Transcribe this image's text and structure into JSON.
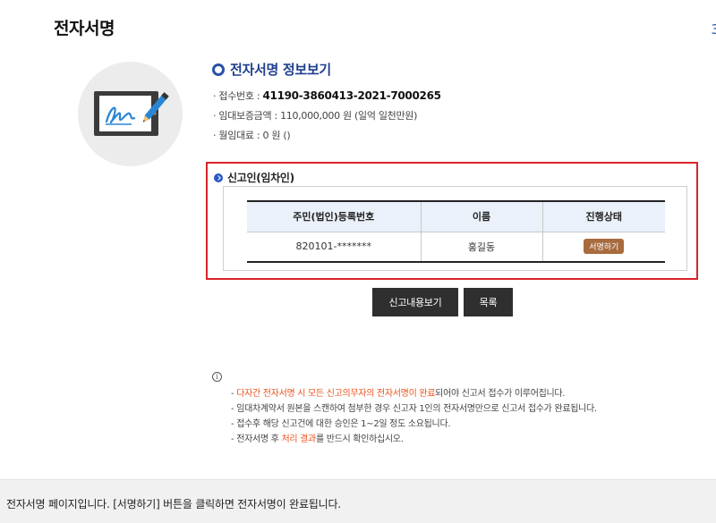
{
  "page": {
    "title": "전자서명",
    "edge_glyph": "3"
  },
  "illustration": {
    "icon": "e-signature-tablet-icon"
  },
  "section": {
    "title": "전자서명 정보보기"
  },
  "info": {
    "receipt_label": "· 접수번호 : ",
    "receipt_value": "41190-3860413-2021-7000265",
    "deposit": "· 임대보증금액 : 110,000,000 원 (일억 일천만원)",
    "rent": "· 월임대료 : 0 원 ()"
  },
  "reporter": {
    "title": "신고인(임차인)",
    "columns": [
      "주민(법인)등록번호",
      "이름",
      "진행상태"
    ],
    "rows": [
      {
        "id": "820101-*******",
        "name": "홍길동",
        "status": "서명하기"
      }
    ]
  },
  "buttons": {
    "view": "신고내용보기",
    "list": "목록"
  },
  "notes": {
    "icon": "info-icon",
    "line1_orange": "다자간 전자서명 시 모든 신고의무자의 전자서명이 완료",
    "line1_rest": "되어야 신고서 접수가 이루어집니다.",
    "line2": "임대차계약서 원본을 스캔하여 첨부한 경우 신고자 1인의 전자서명만으로 신고서 접수가 완료됩니다.",
    "line3": "접수후 해당 신고건에 대한 승인은 1~2일 정도 소요됩니다.",
    "line4_pre": "전자서명 후 ",
    "line4_orange": "처리 결과",
    "line4_post": "를 반드시 확인하십시오.",
    "bullet": "- "
  },
  "footer": {
    "text": "전자서명 페이지입니다. [서명하기] 버튼을 클릭하면 전자서명이 완료됩니다."
  },
  "colors": {
    "accent": "#1e3f8f",
    "highlight_border": "#d9232b",
    "button_bg": "#2f2f2f",
    "badge_bg": "#a86b3e",
    "note_orange": "#e8541e"
  }
}
